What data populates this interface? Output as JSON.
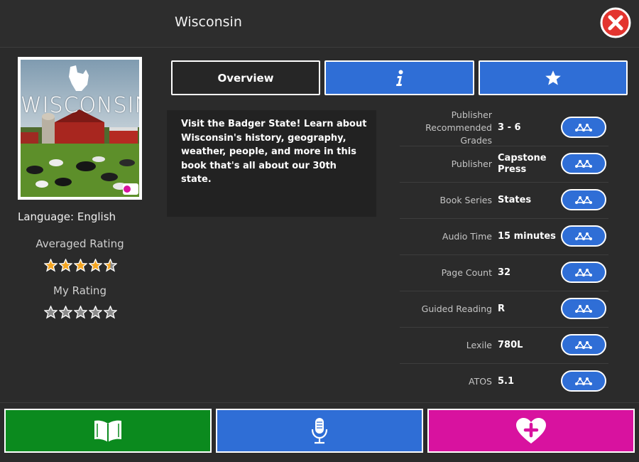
{
  "header": {
    "title": "Wisconsin",
    "close_icon": "close-icon"
  },
  "book": {
    "cover_title": "WISCONSIN",
    "language": "Language: English",
    "averaged_rating_label": "Averaged Rating",
    "averaged_rating": 4.5,
    "my_rating_label": "My Rating",
    "my_rating": 0,
    "description": "Visit the Badger State! Learn about Wisconsin's history, geography, weather, people, and more in this book that's all about our 30th state."
  },
  "tabs": [
    {
      "label": "Overview",
      "icon": ""
    },
    {
      "label": "",
      "icon": "info-icon"
    },
    {
      "label": "",
      "icon": "star-icon"
    }
  ],
  "metadata": [
    {
      "label": "Publisher Recommended Grades",
      "value": "3 - 6"
    },
    {
      "label": "Publisher",
      "value": "Capstone Press"
    },
    {
      "label": "Book Series",
      "value": "States"
    },
    {
      "label": "Audio Time",
      "value": "15 minutes"
    },
    {
      "label": "Page Count",
      "value": "32"
    },
    {
      "label": "Guided Reading",
      "value": "R"
    },
    {
      "label": "Lexile",
      "value": "780L"
    },
    {
      "label": "ATOS",
      "value": "5.1"
    }
  ],
  "footer": {
    "read_icon": "open-book-icon",
    "record_icon": "microphone-icon",
    "favorite_icon": "heart-plus-icon"
  },
  "colors": {
    "blue": "#2f6ed6",
    "green": "#0b8a1e",
    "magenta": "#d8129f",
    "star_filled": "#f5a623",
    "close_red": "#e3342f"
  }
}
